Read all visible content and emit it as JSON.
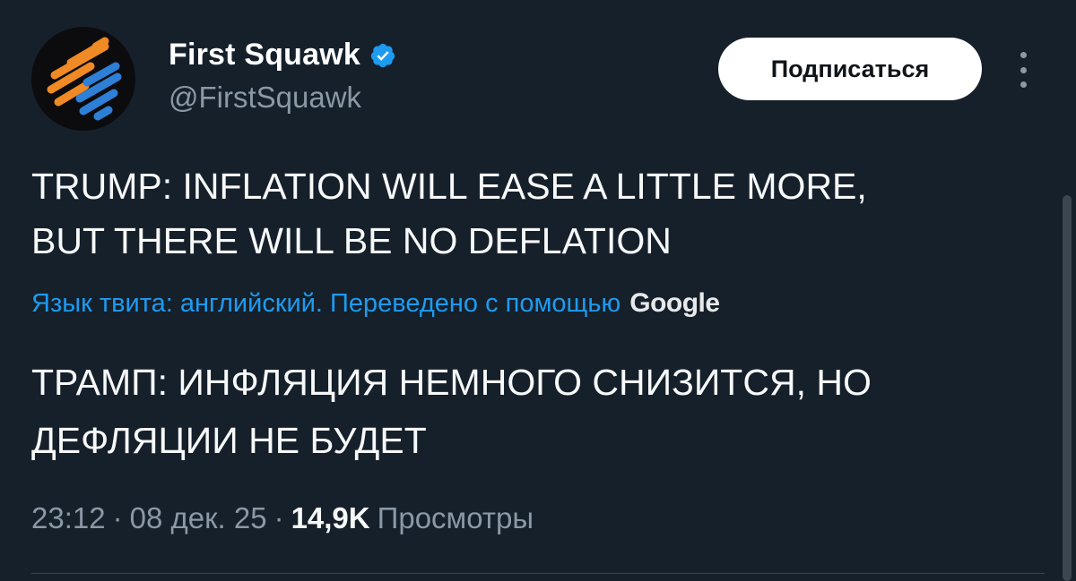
{
  "account": {
    "display_name": "First Squawk",
    "handle": "@FirstSquawk",
    "verified": true
  },
  "follow_button": {
    "label": "Подписаться"
  },
  "tweet": {
    "text_line_1": "TRUMP: INFLATION WILL EASE A LITTLE MORE,",
    "text_line_2": "BUT THERE WILL BE NO DEFLATION",
    "translation_notice": "Язык твита: английский. Переведено с помощью",
    "translation_provider": "Google",
    "translated_line_1": "ТРАМП: ИНФЛЯЦИЯ НЕМНОГО СНИЗИТСЯ, НО",
    "translated_line_2": "ДЕФЛЯЦИИ НЕ БУДЕТ",
    "time": "23:12",
    "separator": "·",
    "date": "08 дек. 25",
    "views_count": "14,9K",
    "views_label": "Просмотры"
  },
  "colors": {
    "background": "#15202b",
    "accent": "#1d9bf0",
    "avatar_orange": "#f08a24",
    "avatar_blue": "#2e7fd6"
  },
  "icons": {
    "avatar": "first-squawk-logo",
    "verified": "verified-badge-icon",
    "more": "more-vertical-icon"
  }
}
